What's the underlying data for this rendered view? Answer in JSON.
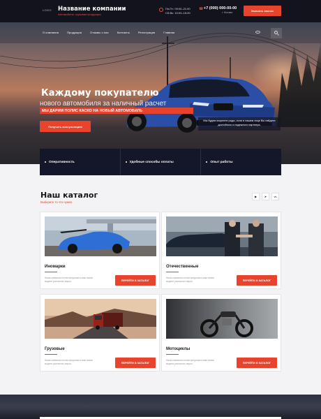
{
  "header": {
    "logo": "LOGO",
    "company_name": "Название компании",
    "company_tagline": "Автомобили, грузовая продукция",
    "hours_line1": "Пн-Пт: 09:00–21:00",
    "hours_line2": "Сб-Вс: 10:00–15:00",
    "phone": "+7 (000) 000-00-00",
    "city": "г. Москва",
    "call_button": "Заказать звонок"
  },
  "nav": {
    "items": [
      "О компании",
      "Продукция",
      "Отзывы о нас",
      "Контакты",
      "Регистрация",
      "Главная"
    ]
  },
  "hero": {
    "title": "Каждому покупателю",
    "subtitle": "нового автомобиля за наличный расчет",
    "badge": "МЫ ДАРИМ ПОЛИС КАСКО НА НОВЫЙ АВТОМОБИЛЬ",
    "consult_button": "Получить консультацию",
    "note": "Мы будем искренне рады, если в нашем лице Вы найдете достойного и надежного партнера."
  },
  "features": [
    "Оперативность",
    "Удобные способы оплаты",
    "Опыт работы"
  ],
  "catalog": {
    "title": "Наш каталог",
    "subtitle": "Выберите то что нужно",
    "cards": [
      {
        "name": "Иномарки",
        "desc": "Наша компания готова предложить вам новые модели различных марок.",
        "button": "ПЕРЕЙТИ В КАТАЛОГ"
      },
      {
        "name": "Отечественные",
        "desc": "Наша компания готова предложить вам новые модели различных марок.",
        "button": "ПЕРЕЙТИ В КАТАЛОГ"
      },
      {
        "name": "Грузовые",
        "desc": "Наша компания готова предложить вам новые модели различных марок.",
        "button": "ПЕРЕЙТИ В КАТАЛОГ"
      },
      {
        "name": "Мотоциклы",
        "desc": "Наша компания готова предложить вам новые модели различных марок.",
        "button": "ПЕРЕЙТИ В КАТАЛОГ"
      }
    ]
  },
  "socials": [
    "youtube-icon",
    "telegram-icon",
    "vk-icon"
  ],
  "colors": {
    "accent": "#e8432c",
    "dark": "#12131c"
  }
}
